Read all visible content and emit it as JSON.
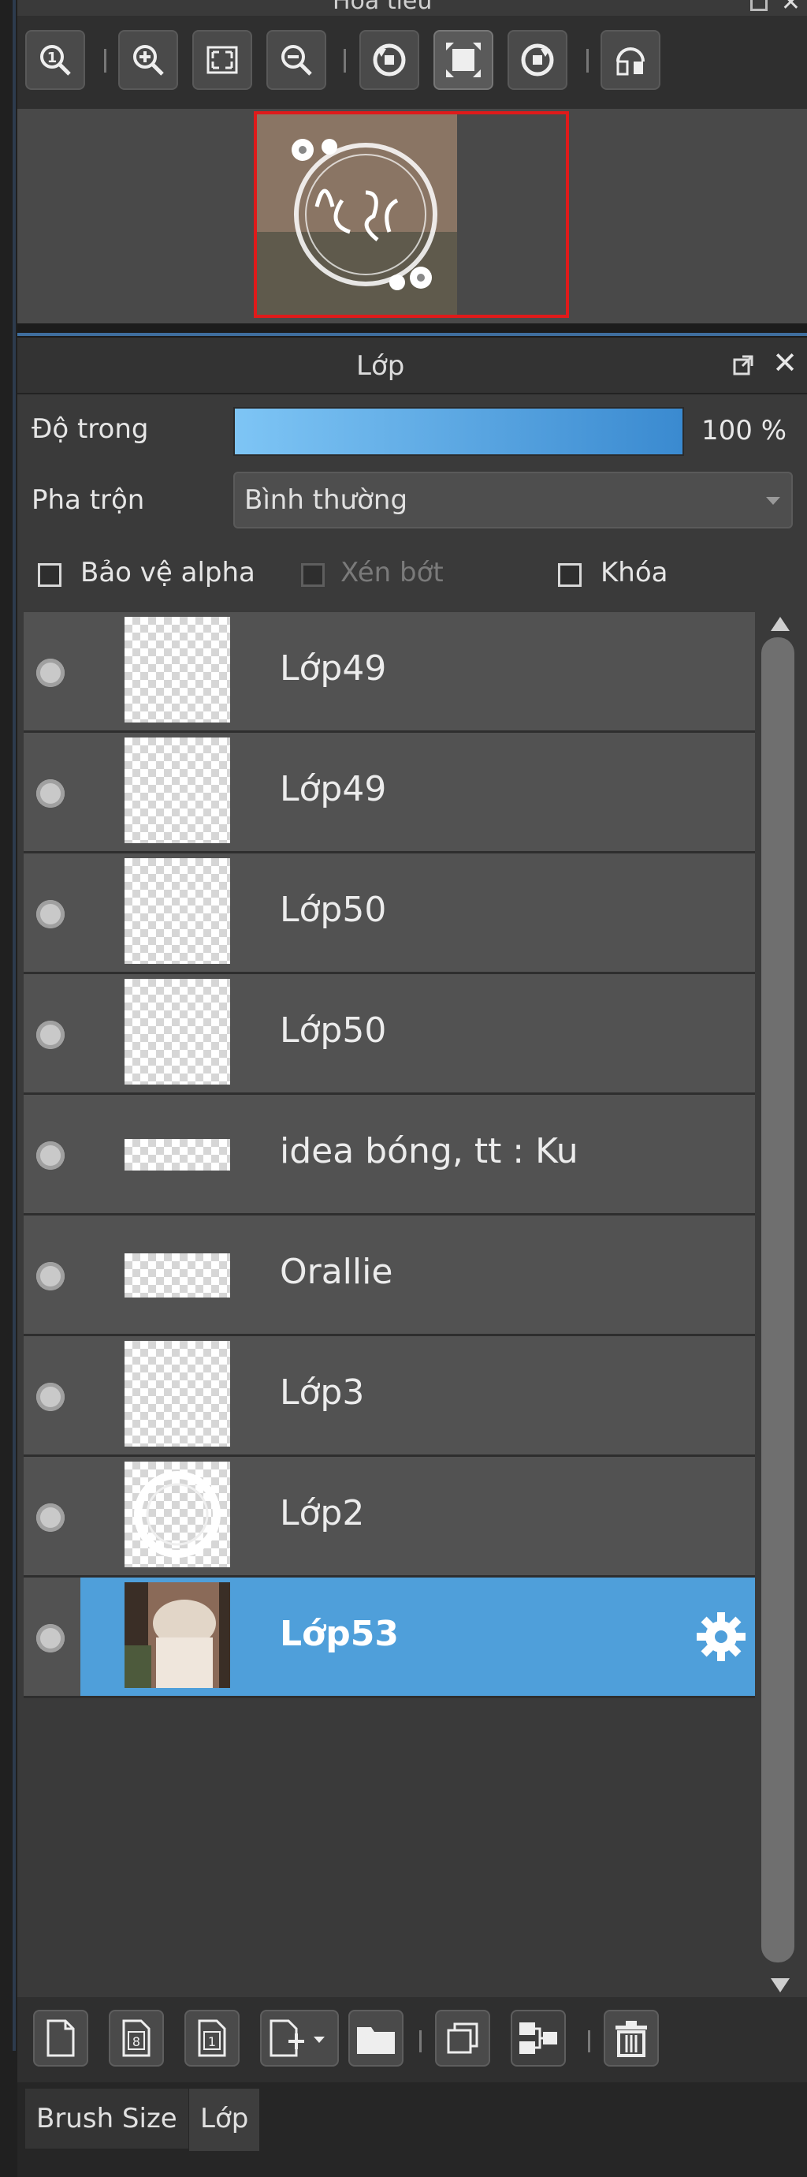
{
  "navigator": {
    "title": "Hoa tieu",
    "toolbar_icons": [
      "zoom-actual-icon",
      "zoom-in-icon",
      "fit-screen-icon",
      "zoom-out-icon",
      "rotate-left-icon",
      "fit-canvas-icon",
      "rotate-right-icon",
      "flip-horizontal-icon"
    ]
  },
  "layer_panel": {
    "title": "Lớp",
    "opacity_label": "Độ trong",
    "opacity_value": "100 %",
    "opacity_fraction": 1.0,
    "blend_label": "Pha trộn",
    "blend_value": "Bình thường",
    "protect_alpha_label": "Bảo vệ alpha",
    "clipping_label": "Xén bớt",
    "lock_label": "Khóa",
    "layers": [
      {
        "name": "Lớp49",
        "thumb": "tall"
      },
      {
        "name": "Lớp49",
        "thumb": "tall"
      },
      {
        "name": "Lớp50",
        "thumb": "tall"
      },
      {
        "name": "Lớp50",
        "thumb": "tall"
      },
      {
        "name": "idea bóng, tt : Ku",
        "thumb": "strip"
      },
      {
        "name": "Orallie",
        "thumb": "strip"
      },
      {
        "name": "Lớp3",
        "thumb": "tall"
      },
      {
        "name": "Lớp2",
        "thumb": "tall"
      },
      {
        "name": "Lớp53",
        "thumb": "photo",
        "selected": true
      }
    ]
  },
  "bottom_toolbar_icons": [
    "new-layer-icon",
    "new-8bit-layer-icon",
    "new-1bit-layer-icon",
    "add-layer-menu-icon",
    "new-folder-icon",
    "duplicate-layer-icon",
    "merge-down-icon",
    "delete-layer-icon"
  ],
  "tabs": [
    "Brush Size",
    "Lớp"
  ],
  "colors": {
    "selection": "#4f9fda",
    "opacity_start": "#7ec5f5",
    "opacity_end": "#3a8ad0"
  }
}
